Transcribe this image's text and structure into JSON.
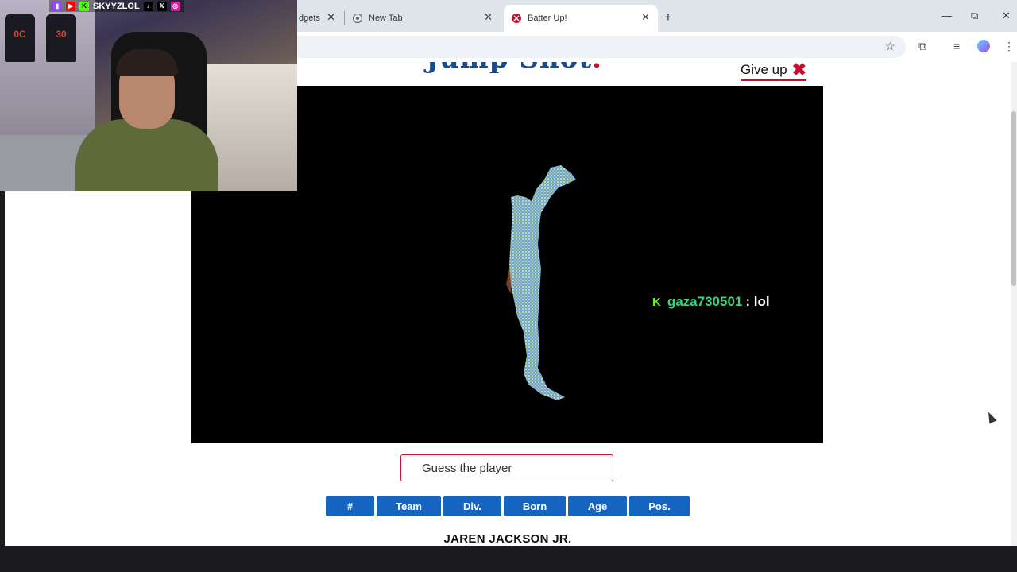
{
  "browser": {
    "tabs": [
      {
        "title": "dgets",
        "active": false
      },
      {
        "title": "New Tab",
        "active": false
      },
      {
        "title": "Batter Up!",
        "active": true
      }
    ],
    "new_tab_symbol": "+",
    "window_controls": {
      "minimize": "—",
      "restore": "⧉",
      "close": "✕"
    }
  },
  "page": {
    "logo_text": "Jump Shot",
    "give_up_label": "Give up",
    "give_up_icon": "✖",
    "chat": {
      "badge": "K",
      "username": "gaza730501",
      "message": ": lol"
    },
    "guess_placeholder": "Guess the player",
    "columns": [
      "#",
      "Team",
      "Div.",
      "Born",
      "Age",
      "Pos."
    ],
    "answer": "JAREN JACKSON JR."
  },
  "overlay": {
    "handle": "SKYYZLOL",
    "jersey_numbers": [
      "0C",
      "30"
    ]
  },
  "colors": {
    "accent_red": "#c8102e",
    "header_blue": "#1565c0",
    "chat_green": "#3ad27a",
    "kick_green": "#53fc18"
  }
}
